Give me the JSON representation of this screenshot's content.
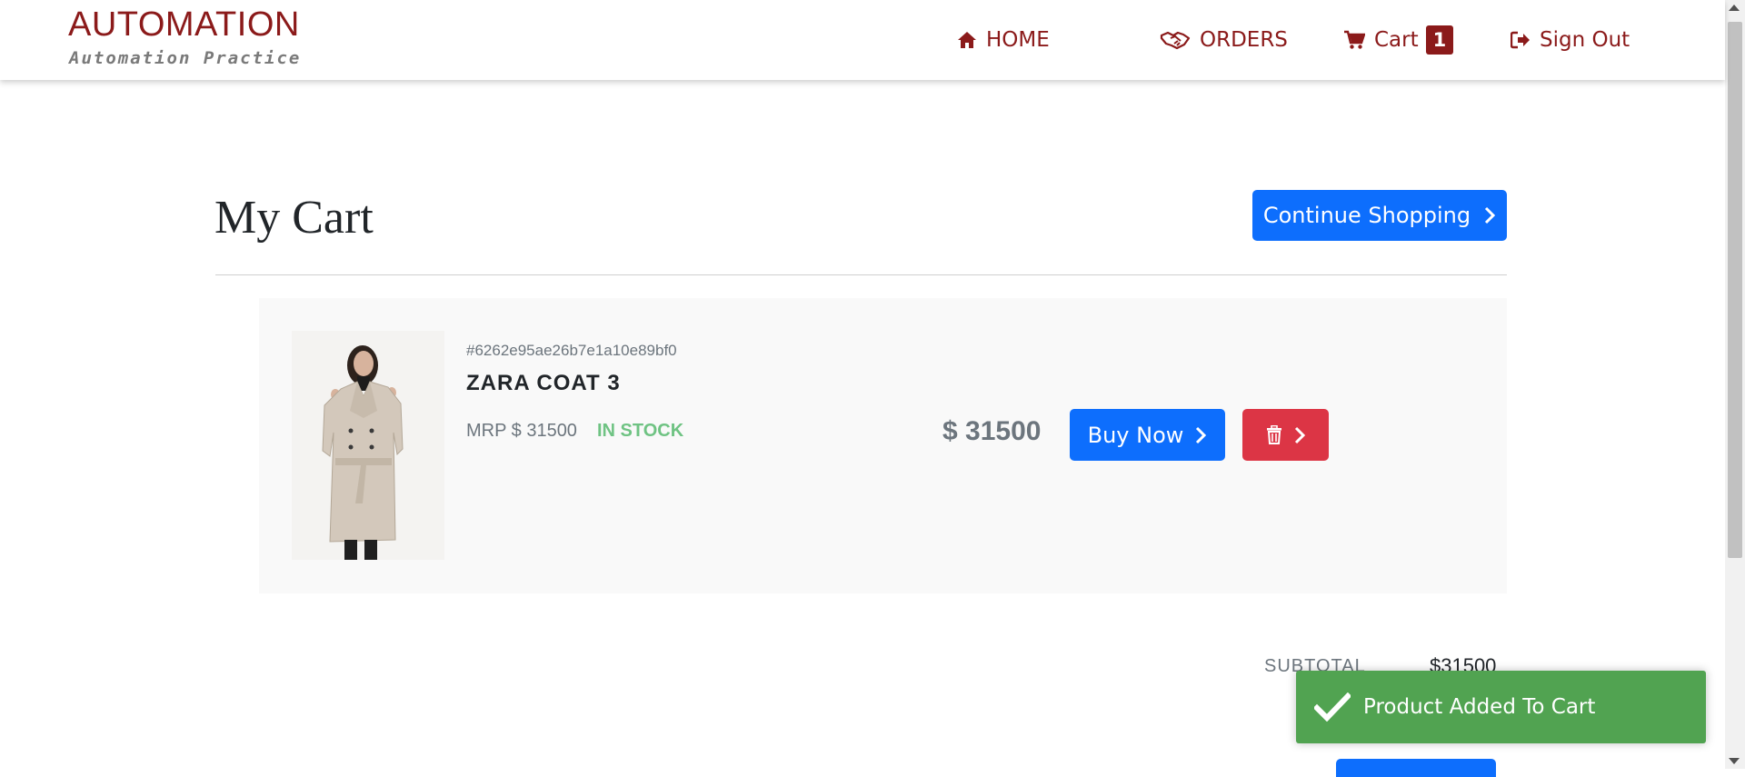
{
  "brand": {
    "title": "AUTOMATION",
    "subtitle": "Automation Practice"
  },
  "nav": {
    "home": {
      "label": "HOME",
      "icon": "home-icon"
    },
    "orders": {
      "label": "ORDERS",
      "icon": "handshake-icon"
    },
    "cart": {
      "label": "Cart",
      "icon": "cart-icon",
      "count": "1"
    },
    "signout": {
      "label": "Sign Out",
      "icon": "sign-out-icon"
    }
  },
  "page": {
    "title": "My Cart",
    "continue_label": "Continue Shopping"
  },
  "cart_items": [
    {
      "id": "#6262e95ae26b7e1a10e89bf0",
      "name": "ZARA COAT 3",
      "mrp": "MRP $ 31500",
      "stock": "IN STOCK",
      "price": "$ 31500",
      "buy_label": "Buy Now"
    }
  ],
  "summary": {
    "subtotal_label": "SUBTOTAL",
    "subtotal_value": "$31500"
  },
  "toast": {
    "message": "Product Added To Cart",
    "icon": "check-icon"
  },
  "colors": {
    "brand": "#8b1a1a",
    "primary": "#0d6efd",
    "danger": "#dc3545",
    "stock": "#6fc383",
    "toast": "#51a351"
  }
}
